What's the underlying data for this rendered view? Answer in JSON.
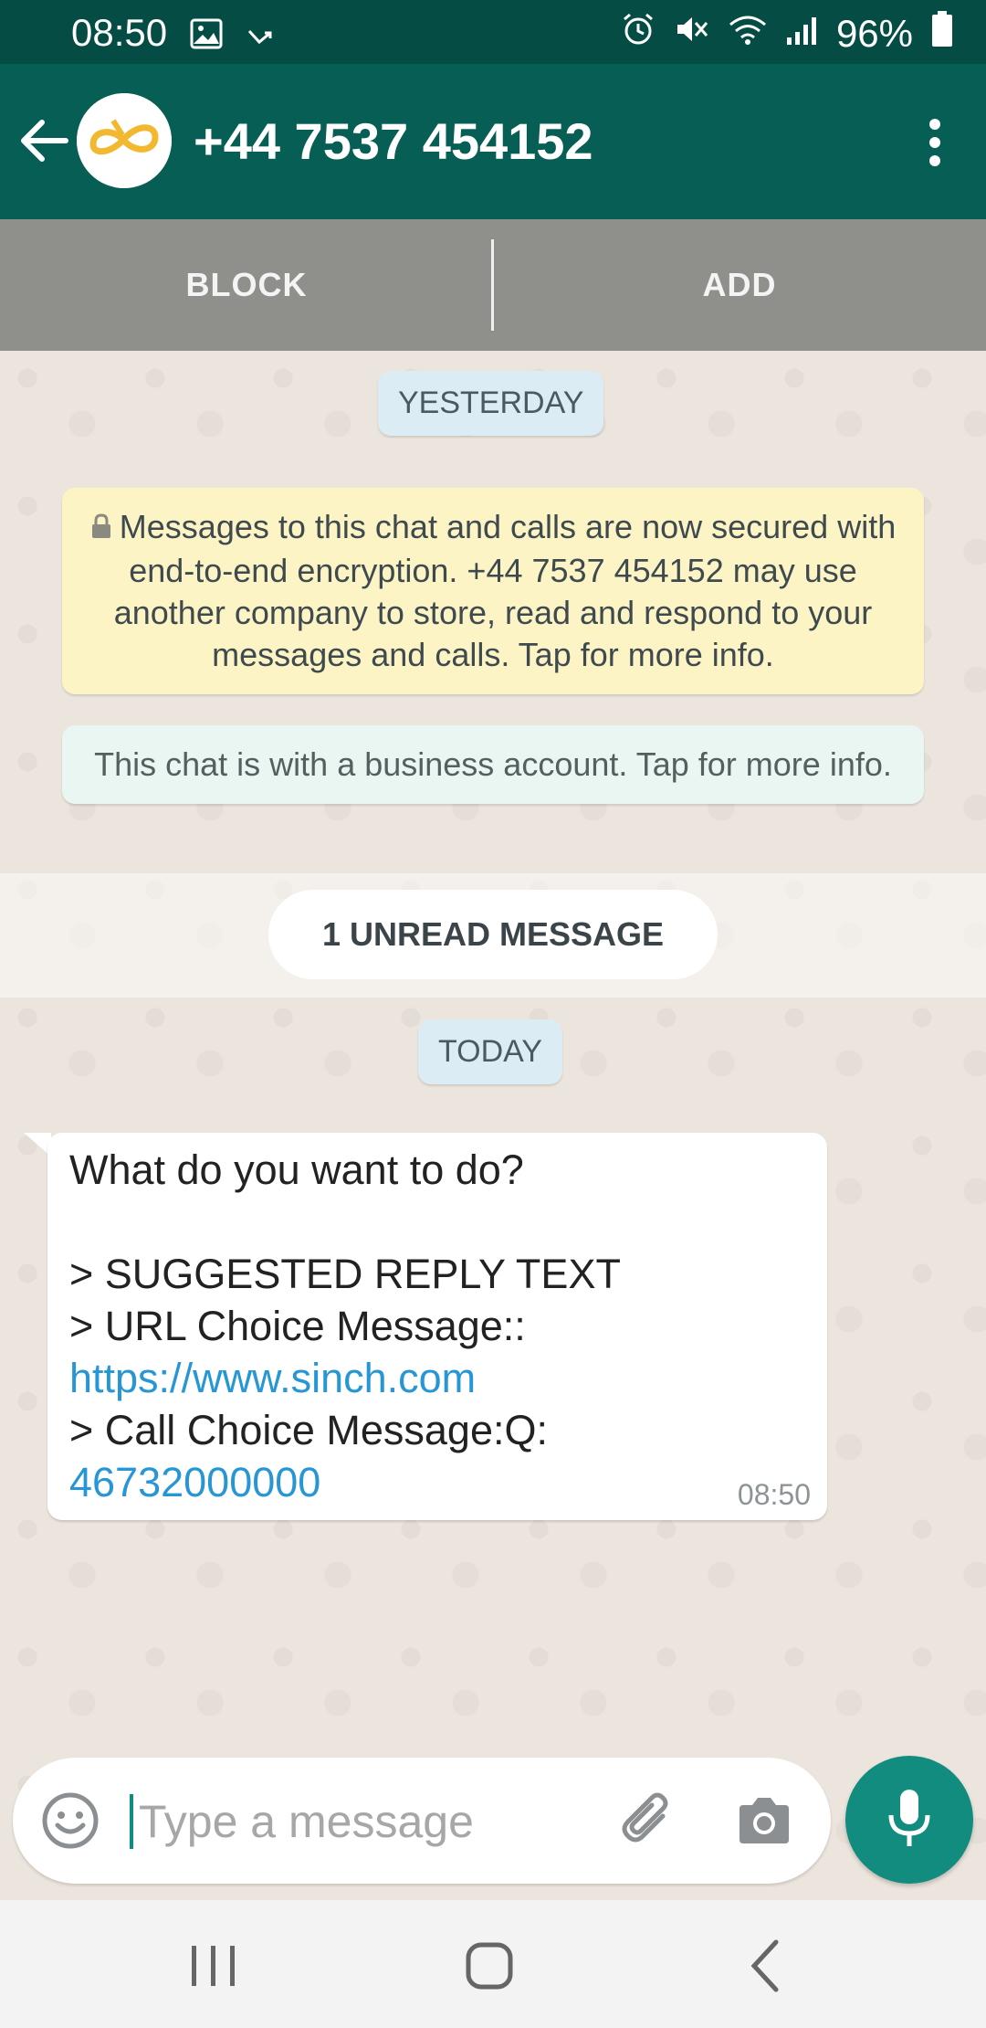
{
  "status_bar": {
    "time": "08:50",
    "battery": "96%",
    "icons": [
      "image-icon",
      "missed-call-icon",
      "alarm-icon",
      "mute-icon",
      "wifi-icon",
      "signal-icon",
      "battery-icon"
    ]
  },
  "header": {
    "contact_name": "+44 7537 454152",
    "avatar": "sinch-logo",
    "accent_color": "#075e54"
  },
  "action_bar": {
    "block_label": "BLOCK",
    "add_label": "ADD"
  },
  "chat": {
    "date_yesterday": "YESTERDAY",
    "encryption_notice": "Messages to this chat and calls are now secured with end-to-end encryption. +44 7537 454152 may use another company to store, read and respond to your messages and calls. Tap for more info.",
    "business_notice": "This chat is with a business account. Tap for more info.",
    "unread_label": "1 UNREAD MESSAGE",
    "date_today": "TODAY",
    "message": {
      "line1": "What do you want to do?",
      "line2": "> SUGGESTED REPLY TEXT",
      "line3": "> URL Choice Message::",
      "link_url": "https://www.sinch.com",
      "line4": "> Call Choice Message:Q:",
      "link_phone": "46732000000",
      "time": "08:50"
    }
  },
  "composer": {
    "placeholder": "Type a message",
    "value": ""
  },
  "colors": {
    "link": "#2796d5",
    "mic_button": "#128c7e",
    "chat_background": "#ece5dd"
  }
}
